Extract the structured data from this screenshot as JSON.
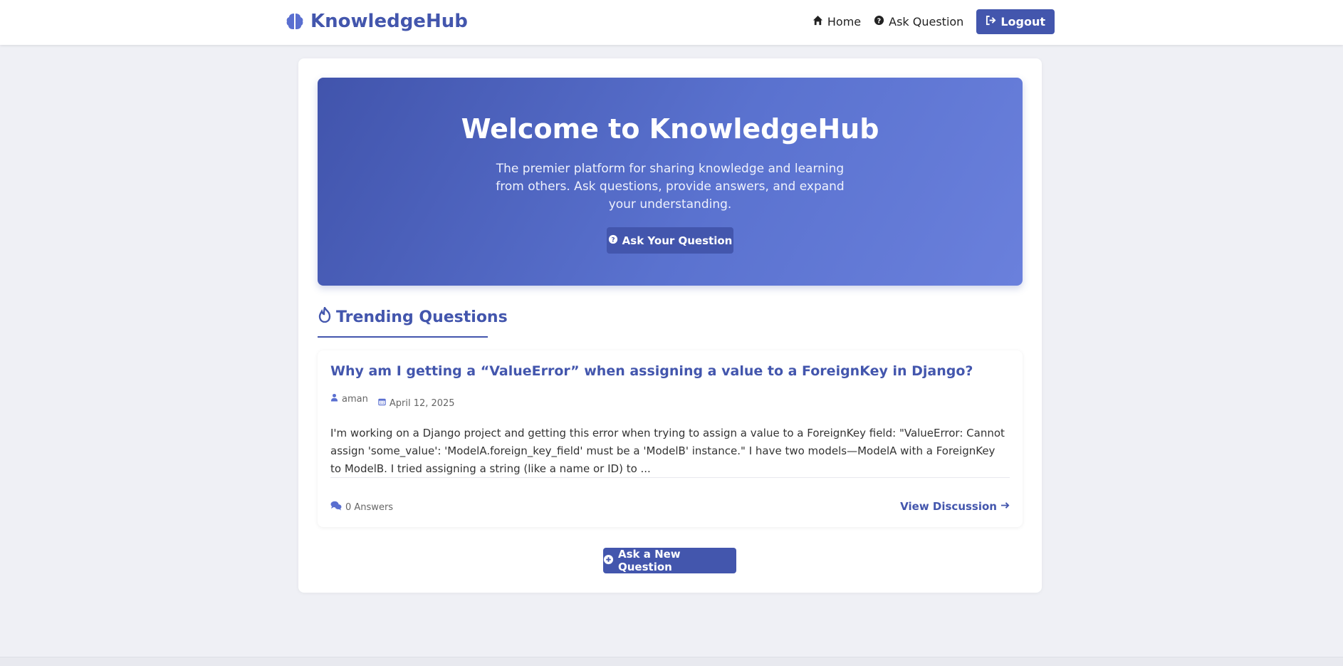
{
  "navbar": {
    "brand": "KnowledgeHub",
    "links": {
      "home": "Home",
      "ask": "Ask Question",
      "logout": "Logout"
    }
  },
  "hero": {
    "title": "Welcome to KnowledgeHub",
    "subtitle": "The premier platform for sharing knowledge and learning from others. Ask questions, provide answers, and expand your understanding.",
    "button": "Ask Your Question"
  },
  "trending": {
    "heading": "Trending Questions",
    "questions": [
      {
        "title": "Why am I getting a “ValueError” when assigning a value to a ForeignKey in Django?",
        "author": "aman",
        "date": "April 12, 2025",
        "excerpt": "I'm working on a Django project and getting this error when trying to assign a value to a ForeignKey field: \"ValueError: Cannot assign 'some_value': 'ModelA.foreign_key_field' must be a 'ModelB' instance.\" I have two models—ModelA with a ForeignKey to ModelB. I tried assigning a string (like a name or ID) to ...",
        "answers": "0 Answers",
        "view_link": "View Discussion"
      }
    ]
  },
  "new_question_button": "Ask a New Question",
  "colors": {
    "primary": "#4356ad",
    "background": "#eff0f5",
    "hero_gradient_start": "#4154ac",
    "hero_gradient_end": "#6a80dc"
  },
  "icons": {
    "brand": "brain-icon",
    "home": "home-icon",
    "ask": "question-circle-icon",
    "logout": "sign-out-icon",
    "trending": "fire-icon",
    "author": "user-icon",
    "date": "calendar-icon",
    "answers": "comments-icon",
    "view": "arrow-right-icon",
    "new_question": "plus-circle-icon"
  }
}
